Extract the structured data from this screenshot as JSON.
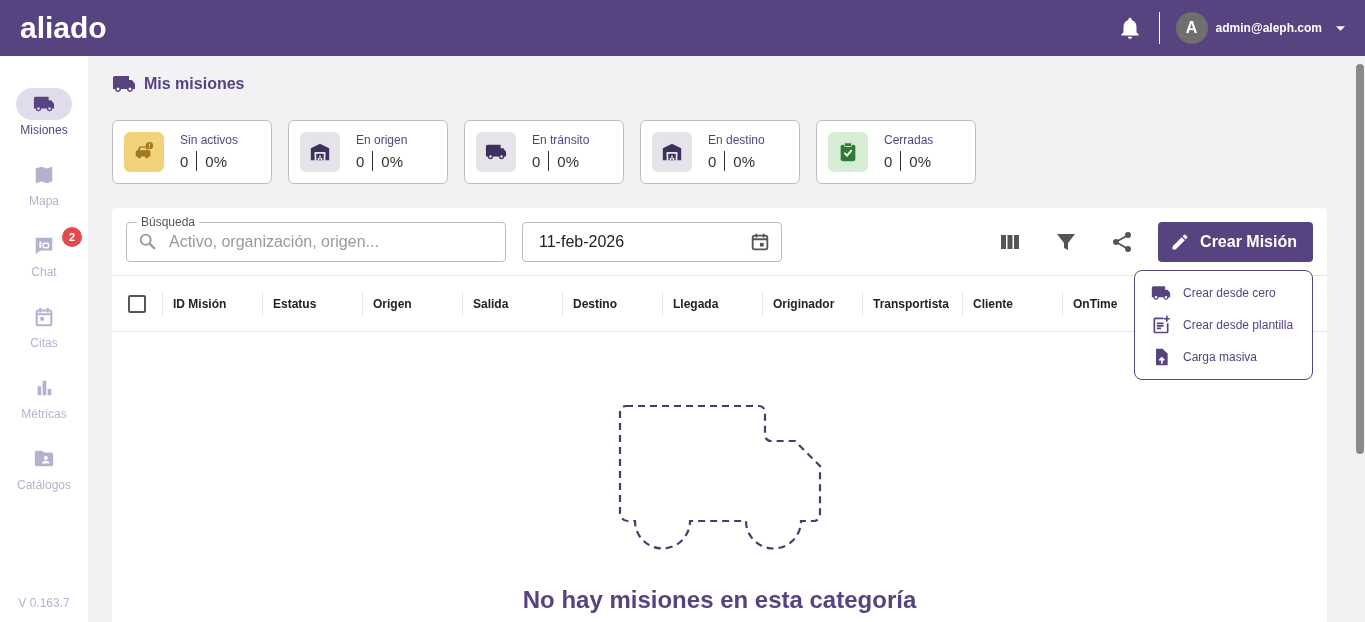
{
  "header": {
    "logo": "aliado",
    "user": {
      "initial": "A",
      "email": "admin@aleph.com"
    }
  },
  "sidebar": {
    "items": [
      {
        "label": "Misiones",
        "kind": "truck",
        "selected": true
      },
      {
        "label": "Mapa",
        "kind": "map",
        "selected": false
      },
      {
        "label": "Chat",
        "kind": "chat",
        "selected": false,
        "badge": "2"
      },
      {
        "label": "Citas",
        "kind": "calendar",
        "selected": false
      },
      {
        "label": "Métricas",
        "kind": "chart",
        "selected": false
      },
      {
        "label": "Catálogos",
        "kind": "folder",
        "selected": false
      }
    ],
    "version": "V 0.163.7"
  },
  "page_title": "Mis misiones",
  "stats": [
    {
      "kind": "idle",
      "label": "Sin activos",
      "count": "0",
      "percent": "0%"
    },
    {
      "kind": "origin",
      "label": "En origen",
      "count": "0",
      "percent": "0%"
    },
    {
      "kind": "transit",
      "label": "En tránsito",
      "count": "0",
      "percent": "0%"
    },
    {
      "kind": "destination",
      "label": "En destino",
      "count": "0",
      "percent": "0%"
    },
    {
      "kind": "closed",
      "label": "Cerradas",
      "count": "0",
      "percent": "0%"
    }
  ],
  "search": {
    "label": "Búsqueda",
    "placeholder": "Activo, organización, origen..."
  },
  "date": {
    "value": "11-feb-2026"
  },
  "create_button": "Crear Misión",
  "create_menu": [
    {
      "kind": "truck",
      "label": "Crear desde cero"
    },
    {
      "kind": "template",
      "label": "Crear desde plantilla"
    },
    {
      "kind": "upload",
      "label": "Carga masiva"
    }
  ],
  "table": {
    "select_all": {
      "checked": false
    },
    "columns": [
      "ID Misión",
      "Estatus",
      "Origen",
      "Salida",
      "Destino",
      "Llegada",
      "Originador",
      "Transportista",
      "Cliente",
      "OnTime"
    ]
  },
  "empty_state": {
    "title": "No hay misiones en esta categoría"
  }
}
